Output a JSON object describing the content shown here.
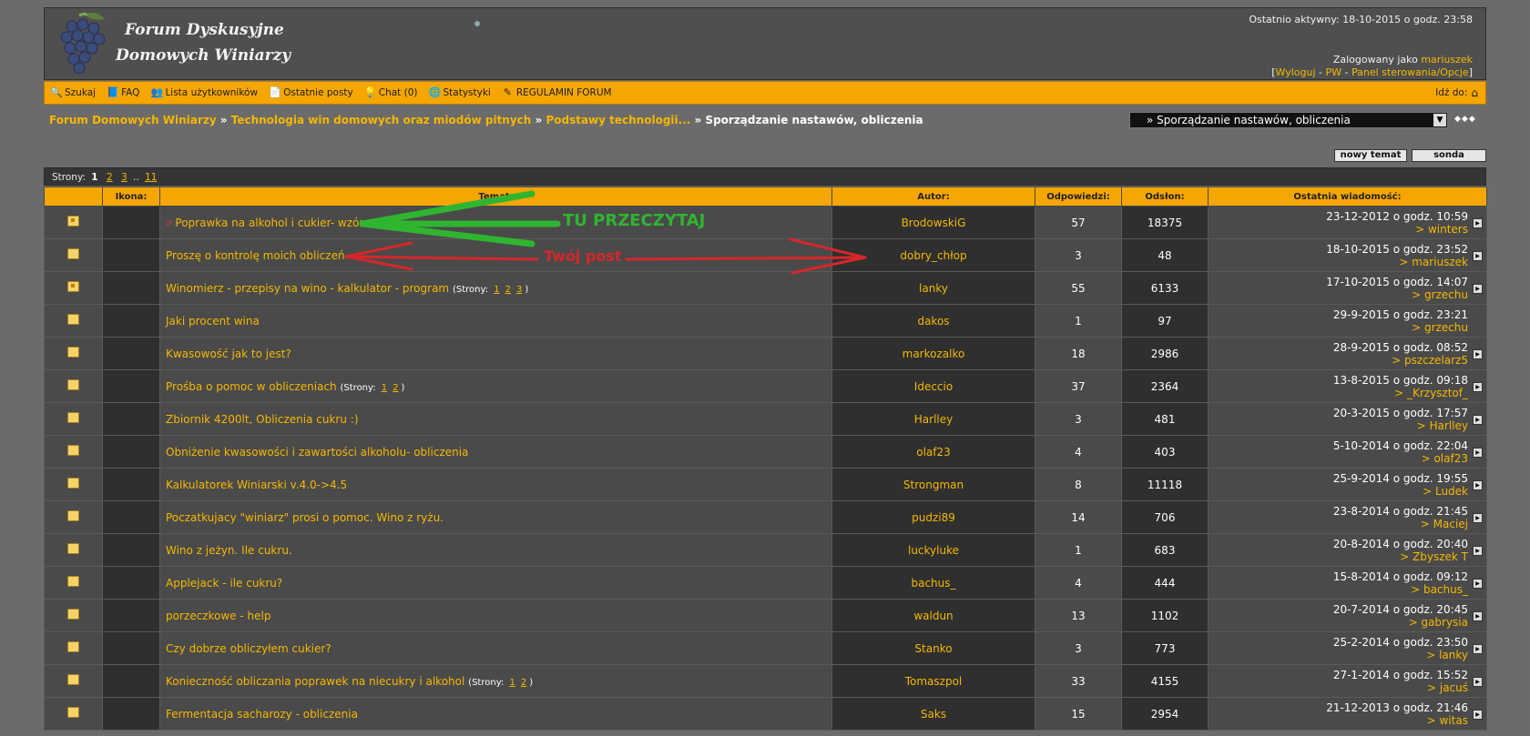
{
  "header": {
    "logo_line1": "Forum Dyskusyjne",
    "logo_line2": "Domowych Winiarzy",
    "last_active": "Ostatnio aktywny: 18-10-2015 o godz. 23:58",
    "logged_as_prefix": "Zalogowany jako ",
    "username": "mariuszek",
    "link_logout": "Wyloguj",
    "link_pw": "PW",
    "link_panel": "Panel sterowania/Opcje"
  },
  "menu": {
    "items": [
      {
        "label": "Szukaj",
        "icon": "search-icon"
      },
      {
        "label": "FAQ",
        "icon": "faq-icon"
      },
      {
        "label": "Lista użytkowników",
        "icon": "users-icon"
      },
      {
        "label": "Ostatnie posty",
        "icon": "posts-icon"
      },
      {
        "label": "Chat (0)",
        "icon": "chat-icon"
      },
      {
        "label": "Statystyki",
        "icon": "stats-icon"
      },
      {
        "label": "REGULAMIN FORUM",
        "icon": "rules-icon"
      }
    ],
    "jump_label": "Idź do:"
  },
  "breadcrumb": {
    "items": [
      "Forum Domowych Winiarzy",
      "Technologia win domowych oraz miodów pitnych",
      "Podstawy technologii..."
    ],
    "current": "Sporządzanie nastawów, obliczenia",
    "separator": " » "
  },
  "jump_select": {
    "value": "» Sporządzanie nastawów, obliczenia"
  },
  "buttons": {
    "new_topic": "nowy temat",
    "poll": "sonda"
  },
  "pager": {
    "label": "Strony:",
    "current": "1",
    "pages": [
      "2",
      "3"
    ],
    "ellipsis": "..",
    "last": "11"
  },
  "table": {
    "headers": [
      "Ikona:",
      "Temat:",
      "Autor:",
      "Odpowiedzi:",
      "Odsłon:",
      "Ostatnia wiadomość:"
    ],
    "rows": [
      {
        "title": "Poprawka na alkohol i cukier- wzór",
        "author": "BrodowskiG",
        "replies": "57",
        "views": "18375",
        "last_date": "23-12-2012 o godz. 10:59",
        "last_user": "> winters"
      },
      {
        "title": "Proszę o kontrolę moich obliczeń",
        "author": "dobry_chłop",
        "replies": "3",
        "views": "48",
        "last_date": "18-10-2015 o godz. 23:52",
        "last_user": "> mariuszek"
      },
      {
        "title": "Winomierz - przepisy na wino - kalkulator - program",
        "author": "lanky",
        "replies": "55",
        "views": "6133",
        "last_date": "17-10-2015 o godz. 14:07",
        "last_user": "> grzechu"
      },
      {
        "title": "Jaki procent wina",
        "author": "dakos",
        "replies": "1",
        "views": "97",
        "last_date": "29-9-2015 o godz. 23:21",
        "last_user": "> grzechu"
      },
      {
        "title": "Kwasowość jak to jest?",
        "author": "markozalko",
        "replies": "18",
        "views": "2986",
        "last_date": "28-9-2015 o godz. 08:52",
        "last_user": "> pszczelarz5"
      },
      {
        "title": "Prośba o pomoc w obliczeniach",
        "author": "Ideccio",
        "replies": "37",
        "views": "2364",
        "last_date": "13-8-2015 o godz. 09:18",
        "last_user": "> _Krzysztof_"
      },
      {
        "title": "Zbiornik 4200lt, Obliczenia cukru :)",
        "author": "Harlley",
        "replies": "3",
        "views": "481",
        "last_date": "20-3-2015 o godz. 17:57",
        "last_user": "> Harlley"
      },
      {
        "title": "Obniżenie kwasowości i zawartości alkoholu- obliczenia",
        "author": "olaf23",
        "replies": "4",
        "views": "403",
        "last_date": "5-10-2014 o godz. 22:04",
        "last_user": "> olaf23"
      },
      {
        "title": "Kalkulatorek Winiarski v.4.0->4.5",
        "author": "Strongman",
        "replies": "8",
        "views": "11118",
        "last_date": "25-9-2014 o godz. 19:55",
        "last_user": "> Ludek"
      },
      {
        "title": "Poczatkujacy \"winiarz\" prosi o pomoc. Wino z ryżu.",
        "author": "pudzi89",
        "replies": "14",
        "views": "706",
        "last_date": "23-8-2014 o godz. 21:45",
        "last_user": "> Maciej"
      },
      {
        "title": "Wino z jeżyn. Ile cukru.",
        "author": "luckyluke",
        "replies": "1",
        "views": "683",
        "last_date": "20-8-2014 o godz. 20:40",
        "last_user": "> Zbyszek T"
      },
      {
        "title": "Applejack - ile cukru?",
        "author": "bachus_",
        "replies": "4",
        "views": "444",
        "last_date": "15-8-2014 o godz. 09:12",
        "last_user": "> bachus_"
      },
      {
        "title": "porzeczkowe - help",
        "author": "waldun",
        "replies": "13",
        "views": "1102",
        "last_date": "20-7-2014 o godz. 20:45",
        "last_user": "> gabrysia"
      },
      {
        "title": "Czy dobrze obliczyłem cukier?",
        "author": "Stanko",
        "replies": "3",
        "views": "773",
        "last_date": "25-2-2014 o godz. 23:50",
        "last_user": "> lanky"
      },
      {
        "title": "Konieczność obliczania poprawek na niecukry i alkohol",
        "author": "Tomaszpol",
        "replies": "33",
        "views": "4155",
        "last_date": "27-1-2014 o godz. 15:52",
        "last_user": "> jacuś"
      },
      {
        "title": "Fermentacja sacharozy - obliczenia",
        "author": "Saks",
        "replies": "15",
        "views": "2954",
        "last_date": "21-12-2013 o godz. 21:46",
        "last_user": "> witas"
      }
    ],
    "subpages_label": "Strony:",
    "row3_pages": [
      "1",
      "2",
      "3"
    ],
    "row6_pages": [
      "1",
      "2"
    ],
    "row15_pages": [
      "1",
      "2"
    ]
  },
  "annotations": {
    "read_here": "TU PRZECZYTAJ",
    "your_post": "Twój post"
  },
  "colors": {
    "accent": "#f5a600",
    "link": "#f5b800",
    "green_arrow": "#2fb52f",
    "red_arrow": "#d7262a"
  }
}
